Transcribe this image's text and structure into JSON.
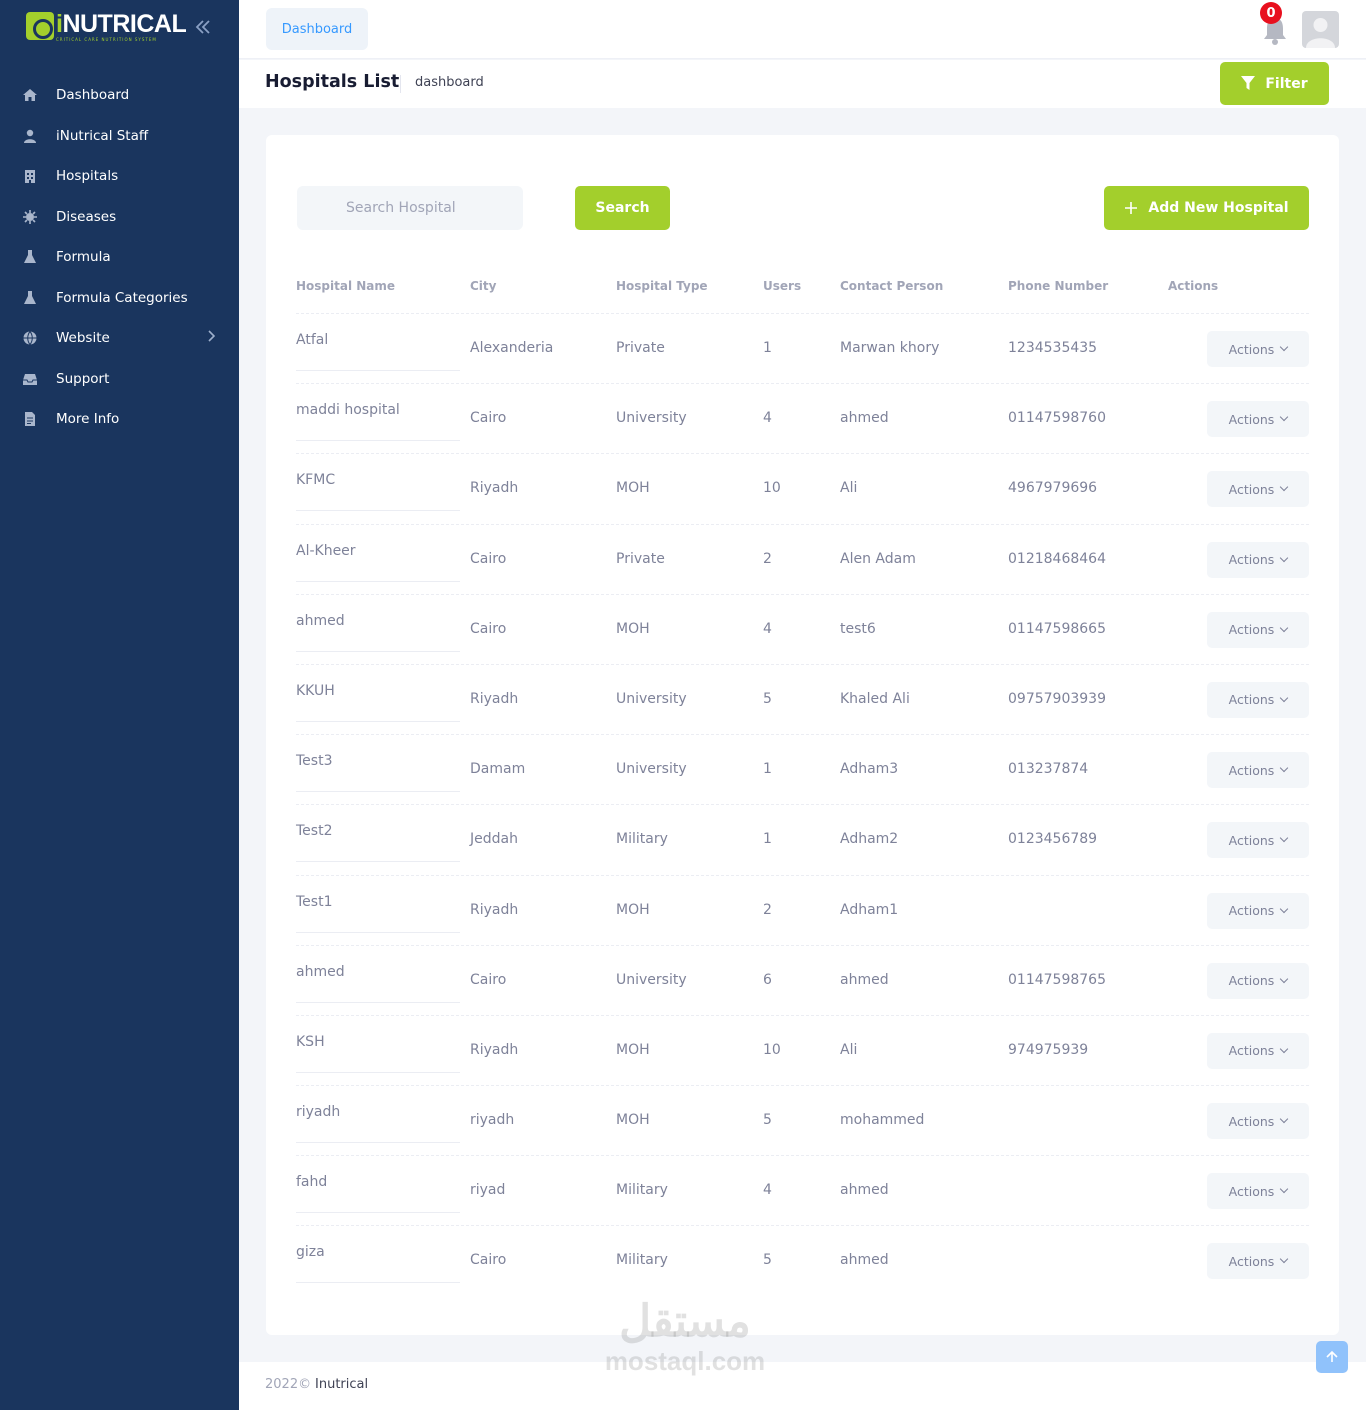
{
  "app": {
    "logo_text_i": "i",
    "logo_text_rest": "NUTRICAL",
    "logo_tagline": "CRITICAL CARE NUTRITION SYSTEM",
    "brand_color": "#a3cf2c",
    "sidebar_color": "#1a355e"
  },
  "sidebar": {
    "items": [
      {
        "label": "Dashboard",
        "icon": "home-icon"
      },
      {
        "label": "iNutrical Staff",
        "icon": "user-icon"
      },
      {
        "label": "Hospitals",
        "icon": "hospital-icon"
      },
      {
        "label": "Diseases",
        "icon": "virus-icon"
      },
      {
        "label": "Formula",
        "icon": "flask-icon"
      },
      {
        "label": "Formula Categories",
        "icon": "flask-icon"
      },
      {
        "label": "Website",
        "icon": "globe-icon"
      },
      {
        "label": "Support",
        "icon": "inbox-icon"
      },
      {
        "label": "More Info",
        "icon": "file-icon"
      }
    ]
  },
  "topbar": {
    "tab_label": "Dashboard",
    "notification_count": "0"
  },
  "subheader": {
    "title": "Hospitals List",
    "crumb": "dashboard",
    "filter_label": "Filter"
  },
  "toolbar": {
    "search_placeholder": "Search Hospital",
    "search_label": "Search",
    "add_label": "Add New Hospital"
  },
  "table": {
    "headers": [
      "Hospital Name",
      "City",
      "Hospital Type",
      "Users",
      "Contact Person",
      "Phone Number",
      "Actions"
    ],
    "action_label": "Actions",
    "rows": [
      [
        "Atfal",
        "Alexanderia",
        "Private",
        "1",
        "Marwan khory",
        "1234535435"
      ],
      [
        "maddi hospital",
        "Cairo",
        "University",
        "4",
        "ahmed",
        "01147598760"
      ],
      [
        "KFMC",
        "Riyadh",
        "MOH",
        "10",
        "Ali",
        "4967979696"
      ],
      [
        "Al-Kheer",
        "Cairo",
        "Private",
        "2",
        "Alen Adam",
        "01218468464"
      ],
      [
        "ahmed",
        "Cairo",
        "MOH",
        "4",
        "test6",
        "01147598665"
      ],
      [
        "KKUH",
        "Riyadh",
        "University",
        "5",
        "Khaled Ali",
        "09757903939"
      ],
      [
        "Test3",
        "Damam",
        "University",
        "1",
        "Adham3",
        "013237874"
      ],
      [
        "Test2",
        "Jeddah",
        "Military",
        "1",
        "Adham2",
        "0123456789"
      ],
      [
        "Test1",
        "Riyadh",
        "MOH",
        "2",
        "Adham1",
        ""
      ],
      [
        "ahmed",
        "Cairo",
        "University",
        "6",
        "ahmed",
        "01147598765"
      ],
      [
        "KSH",
        "Riyadh",
        "MOH",
        "10",
        "Ali",
        "974975939"
      ],
      [
        "riyadh",
        "riyadh",
        "MOH",
        "5",
        "mohammed",
        ""
      ],
      [
        "fahd",
        "riyad",
        "Military",
        "4",
        "ahmed",
        ""
      ],
      [
        "giza",
        "Cairo",
        "Military",
        "5",
        "ahmed",
        ""
      ]
    ]
  },
  "footer": {
    "year": "2022©",
    "brand": "Inutrical"
  },
  "watermark": {
    "arabic": "مستقل",
    "latin": "mostaql.com"
  }
}
